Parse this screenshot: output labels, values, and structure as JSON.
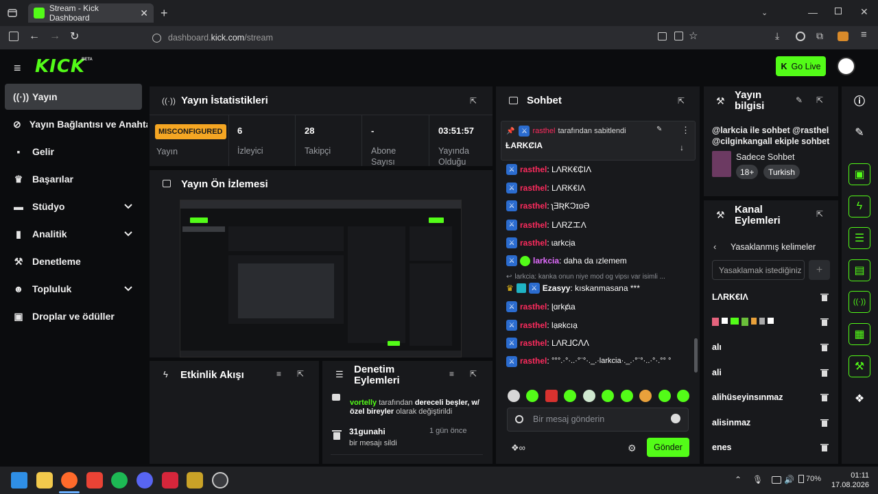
{
  "browser": {
    "tab_title": "Stream - Kick Dashboard",
    "url_host": "dashboard.",
    "url_domain": "kick.com",
    "url_path": "/stream"
  },
  "header": {
    "logo": "KICK",
    "logo_badge": "BETA",
    "go_live": "Go Live"
  },
  "sidebar": {
    "items": [
      {
        "label": "Yayın",
        "icon": "broadcast-icon"
      },
      {
        "label": "Yayın Bağlantısı ve Anahtar",
        "icon": "link-icon"
      },
      {
        "label": "Gelir",
        "icon": "money-icon"
      },
      {
        "label": "Başarılar",
        "icon": "trophy-icon"
      },
      {
        "label": "Stüdyo",
        "icon": "studio-icon"
      },
      {
        "label": "Analitik",
        "icon": "analytics-icon"
      },
      {
        "label": "Denetleme",
        "icon": "wrench-icon"
      },
      {
        "label": "Topluluk",
        "icon": "community-icon"
      },
      {
        "label": "Droplar ve ödüller",
        "icon": "gift-icon"
      }
    ]
  },
  "stats": {
    "title": "Yayın İstatistikleri",
    "status_badge": "MISCONFIGURED",
    "status_label": "Yayın",
    "items": [
      {
        "value": "6",
        "label": "İzleyici"
      },
      {
        "value": "28",
        "label": "Takipçi"
      },
      {
        "value": "-",
        "label": "Abone Sayısı"
      },
      {
        "value": "03:51:57",
        "label": "Yayında Olduğu"
      }
    ]
  },
  "preview": {
    "title": "Yayın Ön İzlemesi"
  },
  "activity": {
    "title": "Etkinlik Akışı"
  },
  "mod_actions": {
    "title": "Denetim Eylemleri",
    "entry1_user": "vortelly",
    "entry1_mid": "tarafından",
    "entry1_bold": "dereceli beşler, w/ özel bireyler",
    "entry1_tail": "olarak değiştirildi",
    "entry2_user": "31gunahi",
    "entry2_time": "1 gün önce",
    "entry2_text": "bir mesajı sildi"
  },
  "chat": {
    "title": "Sohbet",
    "pinned_by": "rasthel",
    "pinned_suffix": "tarafından sabitlendi",
    "pinned_text": "ȽARKȻIA",
    "messages": [
      {
        "user": "rasthel",
        "text": "LΛRK€₵ΙΛ"
      },
      {
        "user": "rasthel",
        "text": "LΛRK€ΙΛ"
      },
      {
        "user": "rasthel",
        "text": "ʅƎƦƘƆɪɑƏ"
      },
      {
        "user": "rasthel",
        "text": "ꓡΛRΖエΛ"
      },
      {
        "user": "rasthel",
        "text": "ɩarkcịa"
      },
      {
        "user": "larkcia",
        "text": "daha da ızlemem"
      },
      {
        "user": "Ezasyy",
        "text": "kıskanmasana ***"
      },
      {
        "user": "rasthel",
        "text": "ɭɑrkȼɩa"
      },
      {
        "user": "rasthel",
        "text": "lạʀkcıạ"
      },
      {
        "user": "rasthel",
        "text": "LΛR⅃ᏟꓥΛ"
      },
      {
        "user": "rasthel",
        "text": "°°°.·°·..·°¨°·._.·larkcia·._.·°¨°·..·°·.°° °"
      }
    ],
    "reply_hint": "larkcia: kanka onun niye mod og vipsı var isimli ...",
    "input_placeholder": "Bir mesaj gönderin",
    "send": "Gönder"
  },
  "stream_info": {
    "title": "Yayın bilgisi",
    "description": "@larkcia ile sohbet @rasthel @cilginkangall ekiple sohbet",
    "channel": "Sadece Sohbet",
    "tags": [
      "18+",
      "Turkish"
    ]
  },
  "channel_actions": {
    "title": "Kanal Eylemleri",
    "back_label": "Yasaklanmış kelimeler",
    "input_placeholder": "Yasaklamak istediğiniz",
    "words": [
      "LΛRK€ΙΛ",
      "emoji-row",
      "alı",
      "ali",
      "alihüseyinsınmaz",
      "alisinmaz",
      "enes"
    ]
  },
  "taskbar": {
    "time": "01:11",
    "date": "17.08.2026",
    "battery": "70%"
  },
  "colors": {
    "accent": "#53fc18",
    "badge": "#f5a623",
    "username": "#ff2b5e",
    "panel": "#18191c"
  }
}
